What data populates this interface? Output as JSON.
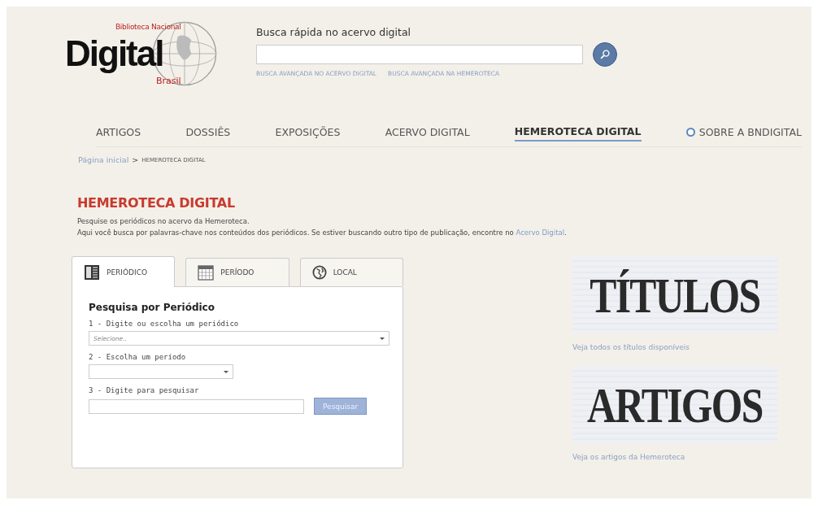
{
  "logo": {
    "top": "Biblioteca Nacional",
    "main": "Digital",
    "bottom": "Brasil"
  },
  "quick_search": {
    "label": "Busca rápida no acervo digital",
    "links": [
      "BUSCA AVANÇADA NO ACERVO DIGITAL",
      "BUSCA AVANÇADA NA HEMEROTECA"
    ]
  },
  "nav": [
    {
      "label": "ARTIGOS",
      "selected": false,
      "kind": "link"
    },
    {
      "label": "DOSSIÊS",
      "selected": false,
      "kind": "link"
    },
    {
      "label": "EXPOSIÇÕES",
      "selected": false,
      "kind": "link"
    },
    {
      "label": "ACERVO DIGITAL",
      "selected": false,
      "kind": "link"
    },
    {
      "label": "HEMEROTECA DIGITAL",
      "selected": true,
      "kind": "link"
    },
    {
      "label": "SOBRE A BNDIGITAL",
      "selected": false,
      "kind": "info"
    }
  ],
  "breadcrumb": {
    "home": "Página inicial",
    "separator": ">",
    "current": "HEMEROTECA DIGITAL"
  },
  "section": {
    "title": "HEMEROTECA DIGITAL",
    "line_1": "Pesquise os periódicos no acervo da Hemeroteca.",
    "line_2": "Aqui você busca por palavras-chave nos conteúdos dos periódicos. Se estiver buscando outro tipo de publicação, encontre no ",
    "line_2_link": "Acervo Digital",
    "line_2_end": "."
  },
  "tabs": [
    {
      "label": "PERIÓDICO",
      "selected": true,
      "kind": "newspaper"
    },
    {
      "label": "PERÍODO",
      "selected": false,
      "kind": "calendar"
    },
    {
      "label": "LOCAL",
      "selected": false,
      "kind": "globe"
    }
  ],
  "form": {
    "title": "Pesquisa por Periódico",
    "fields": [
      {
        "label": "1 - Digite ou escolha um periódico",
        "kind": "select",
        "placeholder": "Selecione..",
        "wide": true
      },
      {
        "label": "2 - Escolha um período",
        "kind": "select",
        "wide": false
      },
      {
        "label": "3 - Digite para pesquisar",
        "kind": "text",
        "button": "Pesquisar"
      }
    ]
  },
  "promos": [
    {
      "banner": "TÍTULOS",
      "link": "Veja todos os títulos disponíveis"
    },
    {
      "banner": "ARTIGOS",
      "link": "Veja os artigos da Hemeroteca"
    }
  ]
}
